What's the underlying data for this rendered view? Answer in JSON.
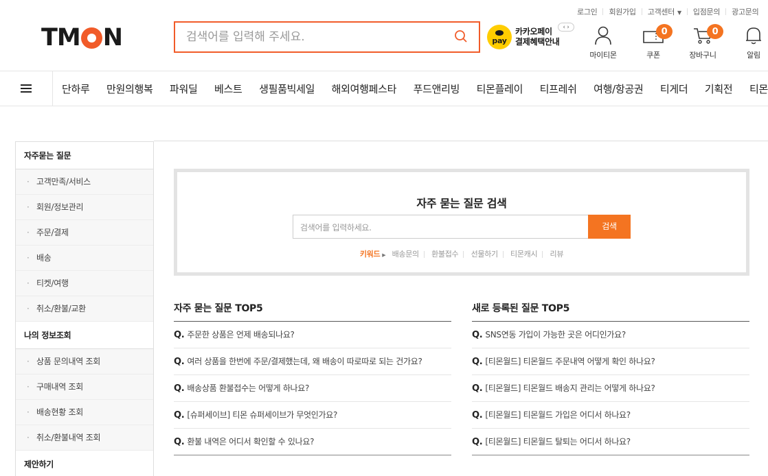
{
  "top_links": [
    "로그인",
    "회원가입",
    "고객센터",
    "입점문의",
    "광고문의"
  ],
  "logo": {
    "pre": "TM",
    "post": "N"
  },
  "search": {
    "placeholder": "검색어를 입력해 주세요."
  },
  "kakao": {
    "badge": "pay",
    "line1": "카카오페이",
    "line2": "결제혜택안내",
    "arrows": "‹ ›"
  },
  "header_icons": {
    "mytmon": "마이티몬",
    "coupon": {
      "label": "쿠폰",
      "count": "0"
    },
    "cart": {
      "label": "장바구니",
      "count": "0"
    },
    "alarm": "알림"
  },
  "gnb": [
    "단하루",
    "만원의행복",
    "파워딜",
    "베스트",
    "생필품빅세일",
    "해외여행페스타",
    "푸드앤리빙",
    "티몬플레이",
    "티프레쉬",
    "여행/항공권",
    "티게더",
    "기획전",
    "티몬"
  ],
  "sidebar": {
    "sections": [
      {
        "title": "자주묻는 질문",
        "items": [
          "고객만족/서비스",
          "회원/정보관리",
          "주문/결제",
          "배송",
          "티켓/여행",
          "취소/환불/교환"
        ]
      },
      {
        "title": "나의 정보조회",
        "items": [
          "상품 문의내역 조회",
          "구매내역 조회",
          "배송현황 조회",
          "취소/환불내역 조회"
        ]
      },
      {
        "title": "제안하기",
        "items": []
      }
    ]
  },
  "faq_search": {
    "title": "자주 묻는 질문 검색",
    "placeholder": "검색어를 입력하세요.",
    "button": "검색",
    "keyword_label": "키워드",
    "keywords": [
      "배송문의",
      "환불접수",
      "선물하기",
      "티몬캐시",
      "리뷰"
    ]
  },
  "top5": {
    "title": "자주 묻는 질문 TOP5",
    "prefix": "Q.",
    "items": [
      "주문한 상품은 언제 배송되나요?",
      "여러 상품을 한번에 주문/결제했는데, 왜 배송이 따로따로 되는 건가요?",
      "배송상품 환불접수는 어떻게 하나요?",
      "[슈퍼세이브] 티몬 슈퍼세이브가 무엇인가요?",
      "환불 내역은 어디서 확인할 수 있나요?"
    ]
  },
  "new5": {
    "title": "새로 등록된 질문 TOP5",
    "prefix": "Q.",
    "items": [
      "SNS연동 가입이 가능한 곳은 어디인가요?",
      "[티몬월드] 티몬월드 주문내역 어떻게 확인 하나요?",
      "[티몬월드] 티몬월드 배송지 관리는 어떻게 하나요?",
      "[티몬월드] 티몬월드 가입은 어디서 하나요?",
      "[티몬월드] 티몬월드 탈퇴는 어디서 하나요?"
    ]
  },
  "colors": {
    "accent": "#f47421",
    "brand_o": "#f15b29",
    "kakao": "#ffcd00"
  }
}
